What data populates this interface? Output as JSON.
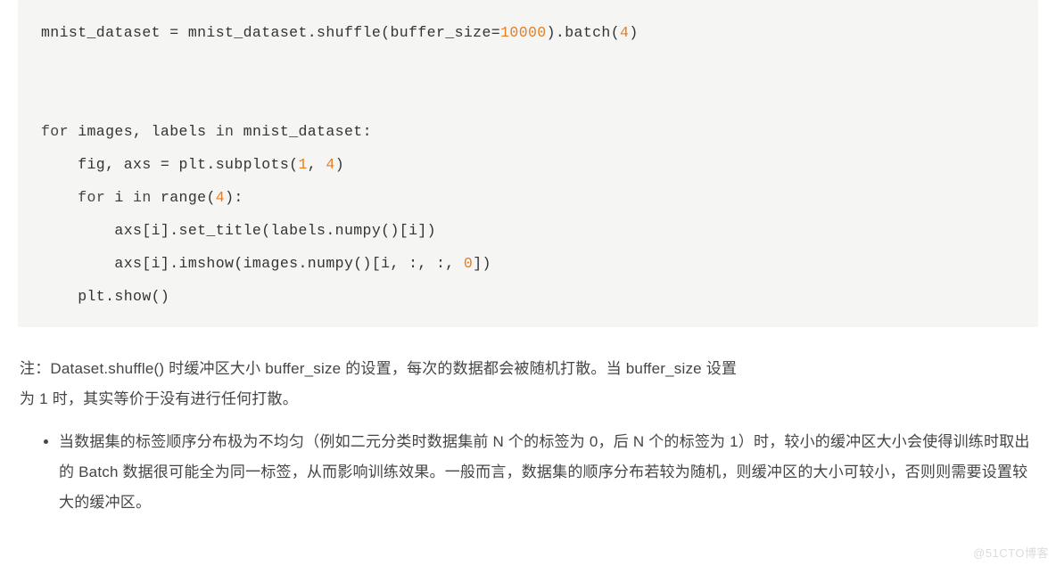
{
  "code": {
    "lines": [
      {
        "type": "code",
        "segments": [
          {
            "t": "mnist_dataset = mnist_dataset.shuffle(buffer_size=",
            "cls": "op"
          },
          {
            "t": "10000",
            "cls": "num"
          },
          {
            "t": ").batch(",
            "cls": "op"
          },
          {
            "t": "4",
            "cls": "num"
          },
          {
            "t": ")",
            "cls": "op"
          }
        ]
      },
      {
        "type": "blank"
      },
      {
        "type": "blank"
      },
      {
        "type": "code",
        "segments": [
          {
            "t": "for",
            "cls": "kw"
          },
          {
            "t": " images, labels ",
            "cls": "op"
          },
          {
            "t": "in",
            "cls": "kw"
          },
          {
            "t": " mnist_dataset:",
            "cls": "op"
          }
        ]
      },
      {
        "type": "code",
        "segments": [
          {
            "t": "    fig, axs = plt.subplots(",
            "cls": "op"
          },
          {
            "t": "1",
            "cls": "num"
          },
          {
            "t": ", ",
            "cls": "op"
          },
          {
            "t": "4",
            "cls": "num"
          },
          {
            "t": ")",
            "cls": "op"
          }
        ]
      },
      {
        "type": "code",
        "segments": [
          {
            "t": "    ",
            "cls": "op"
          },
          {
            "t": "for",
            "cls": "kw"
          },
          {
            "t": " i ",
            "cls": "op"
          },
          {
            "t": "in",
            "cls": "kw"
          },
          {
            "t": " range(",
            "cls": "op"
          },
          {
            "t": "4",
            "cls": "num"
          },
          {
            "t": "):",
            "cls": "op"
          }
        ]
      },
      {
        "type": "code",
        "segments": [
          {
            "t": "        axs[i].set_title(labels.numpy()[i])",
            "cls": "op"
          }
        ]
      },
      {
        "type": "code",
        "segments": [
          {
            "t": "        axs[i].imshow(images.numpy()[i, :, :, ",
            "cls": "op"
          },
          {
            "t": "0",
            "cls": "num"
          },
          {
            "t": "])",
            "cls": "op"
          }
        ]
      },
      {
        "type": "code",
        "segments": [
          {
            "t": "    plt.show()",
            "cls": "op"
          }
        ]
      }
    ]
  },
  "note_line1": "注：Dataset.shuffle() 时缓冲区大小 buffer_size 的设置，每次的数据都会被随机打散。当 buffer_size 设置",
  "note_line2": "为 1 时，其实等价于没有进行任何打散。",
  "bullet": "当数据集的标签顺序分布极为不均匀（例如二元分类时数据集前 N 个的标签为 0，后 N 个的标签为 1）时，较小的缓冲区大小会使得训练时取出的 Batch 数据很可能全为同一标签，从而影响训练效果。一般而言，数据集的顺序分布若较为随机，则缓冲区的大小可较小，否则则需要设置较大的缓冲区。",
  "watermark": "@51CTO博客"
}
